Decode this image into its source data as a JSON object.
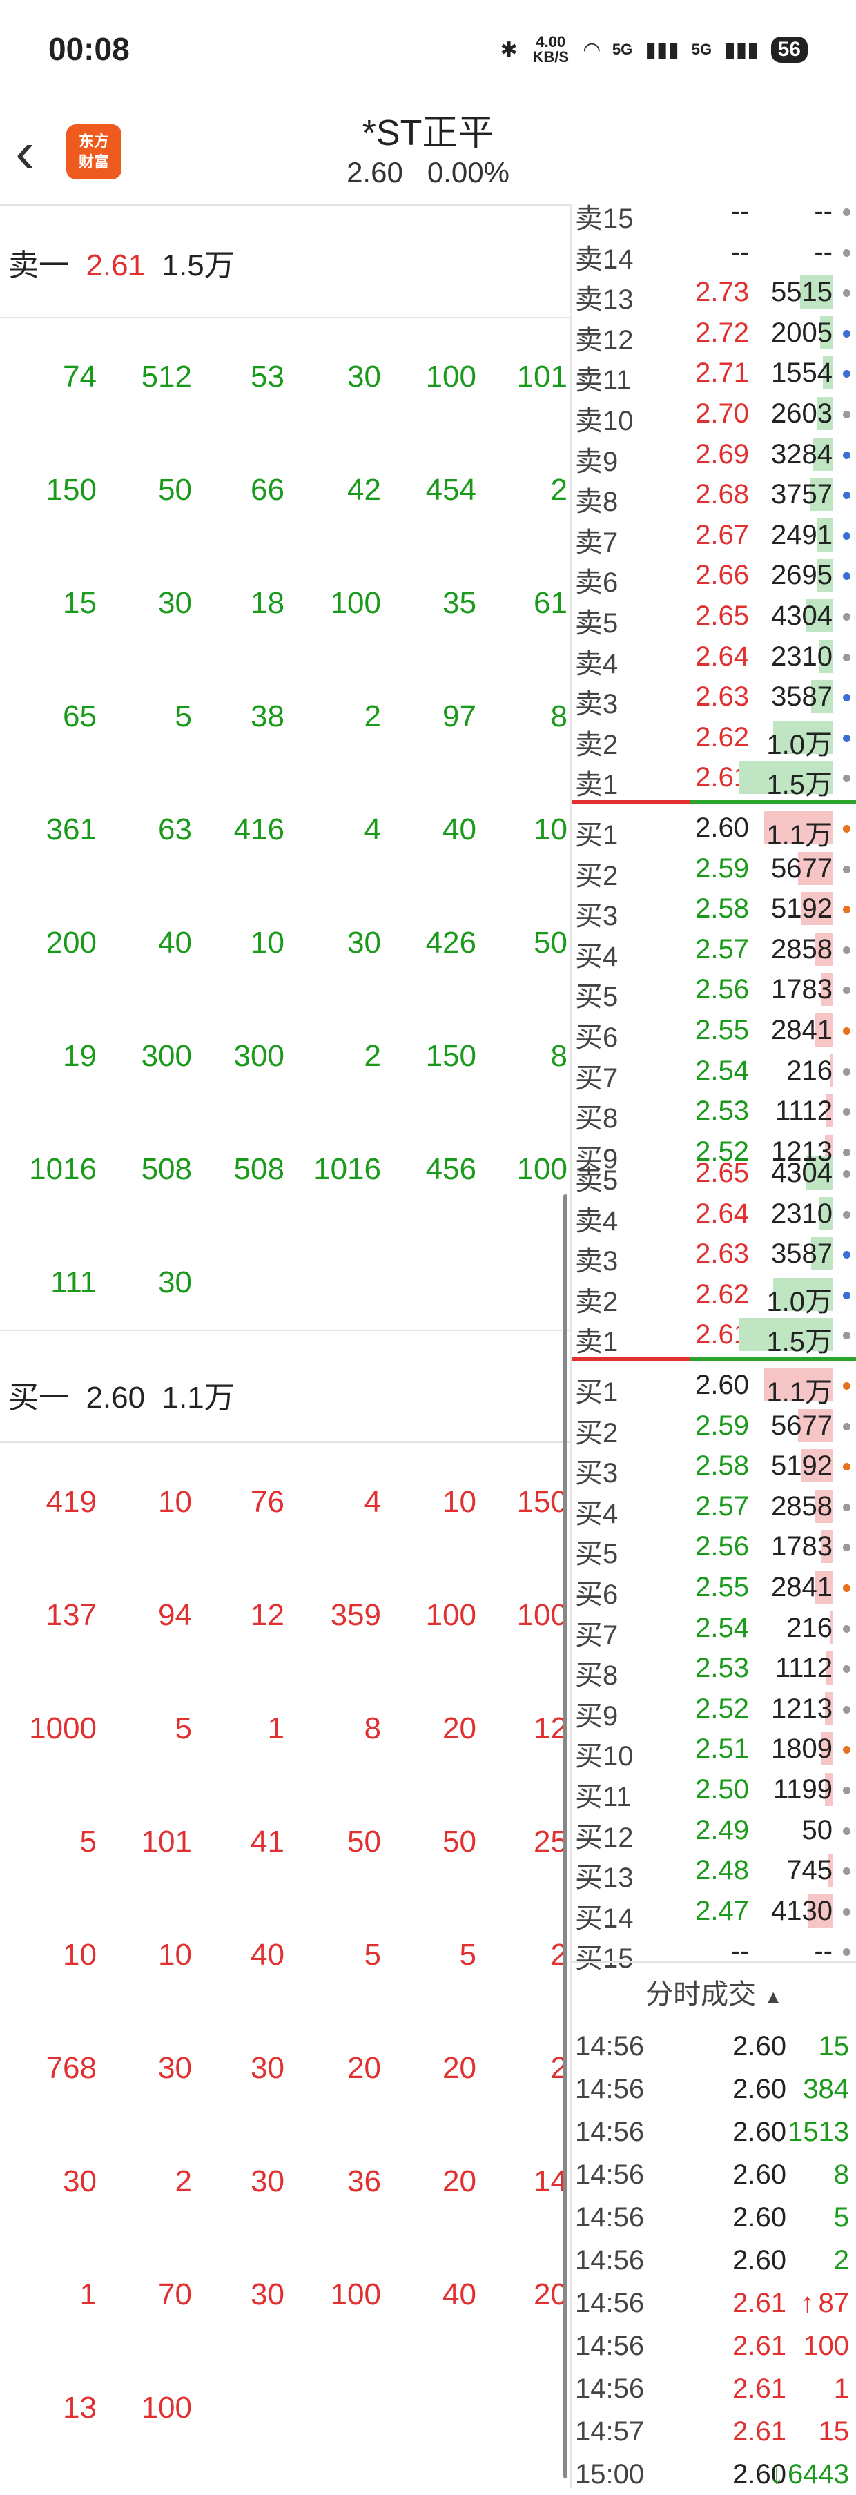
{
  "status_bar": {
    "time": "00:08",
    "net_speed": "4.00 KB/S",
    "signal1": "5G",
    "signal2": "5G",
    "battery": "56"
  },
  "header": {
    "back_icon": "chevron-left-icon",
    "logo_line1": "东方",
    "logo_line2": "财富",
    "title": "*ST正平",
    "price": "2.60",
    "change": "0.00%"
  },
  "left": {
    "sell_header": {
      "label": "卖一",
      "price": "2.61",
      "volume": "1.5万"
    },
    "sell_rows": [
      [
        "74",
        "512",
        "53",
        "30",
        "100",
        "101"
      ],
      [
        "150",
        "50",
        "66",
        "42",
        "454",
        "2"
      ],
      [
        "15",
        "30",
        "18",
        "100",
        "35",
        "61"
      ],
      [
        "65",
        "5",
        "38",
        "2",
        "97",
        "8"
      ],
      [
        "361",
        "63",
        "416",
        "4",
        "40",
        "10"
      ],
      [
        "200",
        "40",
        "10",
        "30",
        "426",
        "50"
      ],
      [
        "19",
        "300",
        "300",
        "2",
        "150",
        "8"
      ],
      [
        "1016",
        "508",
        "508",
        "1016",
        "456",
        "100"
      ],
      [
        "111",
        "30",
        "",
        "",
        "",
        ""
      ]
    ],
    "buy_header": {
      "label": "买一",
      "price": "2.60",
      "volume": "1.1万"
    },
    "buy_rows": [
      [
        "419",
        "10",
        "76",
        "4",
        "10",
        "150"
      ],
      [
        "137",
        "94",
        "12",
        "359",
        "100",
        "100"
      ],
      [
        "1000",
        "5",
        "1",
        "8",
        "20",
        "12"
      ],
      [
        "5",
        "101",
        "41",
        "50",
        "50",
        "25"
      ],
      [
        "10",
        "10",
        "40",
        "5",
        "5",
        "2"
      ],
      [
        "768",
        "30",
        "30",
        "20",
        "20",
        "2"
      ],
      [
        "30",
        "2",
        "30",
        "36",
        "20",
        "14"
      ],
      [
        "1",
        "70",
        "30",
        "100",
        "40",
        "20"
      ],
      [
        "13",
        "100",
        "",
        "",
        "",
        ""
      ]
    ]
  },
  "right": {
    "book1": [
      {
        "label": "卖15",
        "price": "--",
        "vol": "--",
        "side": "sell",
        "dot": "#999999",
        "fill": 0
      },
      {
        "label": "卖14",
        "price": "--",
        "vol": "--",
        "side": "sell",
        "dot": "#999999",
        "fill": 0
      },
      {
        "label": "卖13",
        "price": "2.73",
        "vol": "5515",
        "side": "sell",
        "dot": "#999999",
        "fill": 0.35
      },
      {
        "label": "卖12",
        "price": "2.72",
        "vol": "2005",
        "side": "sell",
        "dot": "#3b6fd8",
        "fill": 0.13
      },
      {
        "label": "卖11",
        "price": "2.71",
        "vol": "1554",
        "side": "sell",
        "dot": "#3b6fd8",
        "fill": 0.1
      },
      {
        "label": "卖10",
        "price": "2.70",
        "vol": "2603",
        "side": "sell",
        "dot": "#999999",
        "fill": 0.17
      },
      {
        "label": "卖9",
        "price": "2.69",
        "vol": "3284",
        "side": "sell",
        "dot": "#3b6fd8",
        "fill": 0.21
      },
      {
        "label": "卖8",
        "price": "2.68",
        "vol": "3757",
        "side": "sell",
        "dot": "#3b6fd8",
        "fill": 0.24
      },
      {
        "label": "卖7",
        "price": "2.67",
        "vol": "2491",
        "side": "sell",
        "dot": "#3b6fd8",
        "fill": 0.16
      },
      {
        "label": "卖6",
        "price": "2.66",
        "vol": "2695",
        "side": "sell",
        "dot": "#3b6fd8",
        "fill": 0.17
      },
      {
        "label": "卖5",
        "price": "2.65",
        "vol": "4304",
        "side": "sell",
        "dot": "#999999",
        "fill": 0.28
      },
      {
        "label": "卖4",
        "price": "2.64",
        "vol": "2310",
        "side": "sell",
        "dot": "#999999",
        "fill": 0.15
      },
      {
        "label": "卖3",
        "price": "2.63",
        "vol": "3587",
        "side": "sell",
        "dot": "#3b6fd8",
        "fill": 0.23
      },
      {
        "label": "卖2",
        "price": "2.62",
        "vol": "1.0万",
        "side": "sell",
        "dot": "#3b6fd8",
        "fill": 0.64
      },
      {
        "label": "卖1",
        "price": "2.61",
        "vol": "1.5万",
        "side": "sell",
        "dot": "#999999",
        "fill": 1.0
      },
      {
        "label": "买1",
        "price": "2.60",
        "vol": "1.1万",
        "side": "buy",
        "dot": "#e8721c",
        "fill": 0.73
      },
      {
        "label": "买2",
        "price": "2.59",
        "vol": "5677",
        "side": "buy",
        "dot": "#999999",
        "fill": 0.37
      },
      {
        "label": "买3",
        "price": "2.58",
        "vol": "5192",
        "side": "buy",
        "dot": "#e8721c",
        "fill": 0.34
      },
      {
        "label": "买4",
        "price": "2.57",
        "vol": "2858",
        "side": "buy",
        "dot": "#999999",
        "fill": 0.19
      },
      {
        "label": "买5",
        "price": "2.56",
        "vol": "1783",
        "side": "buy",
        "dot": "#999999",
        "fill": 0.12
      },
      {
        "label": "买6",
        "price": "2.55",
        "vol": "2841",
        "side": "buy",
        "dot": "#e8721c",
        "fill": 0.19
      },
      {
        "label": "买7",
        "price": "2.54",
        "vol": "216",
        "side": "buy",
        "dot": "#999999",
        "fill": 0.02
      },
      {
        "label": "买8",
        "price": "2.53",
        "vol": "1112",
        "side": "buy",
        "dot": "#999999",
        "fill": 0.07
      },
      {
        "label": "买9",
        "price": "2.52",
        "vol": "1213",
        "side": "buy",
        "dot": "#999999",
        "fill": 0.08
      }
    ],
    "book2": [
      {
        "label": "卖5",
        "price": "2.65",
        "vol": "4304",
        "side": "sell",
        "dot": "#999999",
        "fill": 0.28
      },
      {
        "label": "卖4",
        "price": "2.64",
        "vol": "2310",
        "side": "sell",
        "dot": "#999999",
        "fill": 0.15
      },
      {
        "label": "卖3",
        "price": "2.63",
        "vol": "3587",
        "side": "sell",
        "dot": "#3b6fd8",
        "fill": 0.23
      },
      {
        "label": "卖2",
        "price": "2.62",
        "vol": "1.0万",
        "side": "sell",
        "dot": "#3b6fd8",
        "fill": 0.64
      },
      {
        "label": "卖1",
        "price": "2.61",
        "vol": "1.5万",
        "side": "sell",
        "dot": "#999999",
        "fill": 1.0
      },
      {
        "label": "买1",
        "price": "2.60",
        "vol": "1.1万",
        "side": "buy",
        "dot": "#e8721c",
        "fill": 0.73
      },
      {
        "label": "买2",
        "price": "2.59",
        "vol": "5677",
        "side": "buy",
        "dot": "#999999",
        "fill": 0.37
      },
      {
        "label": "买3",
        "price": "2.58",
        "vol": "5192",
        "side": "buy",
        "dot": "#e8721c",
        "fill": 0.34
      },
      {
        "label": "买4",
        "price": "2.57",
        "vol": "2858",
        "side": "buy",
        "dot": "#999999",
        "fill": 0.19
      },
      {
        "label": "买5",
        "price": "2.56",
        "vol": "1783",
        "side": "buy",
        "dot": "#999999",
        "fill": 0.12
      },
      {
        "label": "买6",
        "price": "2.55",
        "vol": "2841",
        "side": "buy",
        "dot": "#e8721c",
        "fill": 0.19
      },
      {
        "label": "买7",
        "price": "2.54",
        "vol": "216",
        "side": "buy",
        "dot": "#999999",
        "fill": 0.02
      },
      {
        "label": "买8",
        "price": "2.53",
        "vol": "1112",
        "side": "buy",
        "dot": "#999999",
        "fill": 0.07
      },
      {
        "label": "买9",
        "price": "2.52",
        "vol": "1213",
        "side": "buy",
        "dot": "#999999",
        "fill": 0.08
      },
      {
        "label": "买10",
        "price": "2.51",
        "vol": "1809",
        "side": "buy",
        "dot": "#e8721c",
        "fill": 0.12
      },
      {
        "label": "买11",
        "price": "2.50",
        "vol": "1199",
        "side": "buy",
        "dot": "#999999",
        "fill": 0.08
      },
      {
        "label": "买12",
        "price": "2.49",
        "vol": "50",
        "side": "buy",
        "dot": "#999999",
        "fill": 0.0
      },
      {
        "label": "买13",
        "price": "2.48",
        "vol": "745",
        "side": "buy",
        "dot": "#999999",
        "fill": 0.05
      },
      {
        "label": "买14",
        "price": "2.47",
        "vol": "4130",
        "side": "buy",
        "dot": "#999999",
        "fill": 0.27
      },
      {
        "label": "买15",
        "price": "--",
        "vol": "--",
        "side": "buy",
        "dot": "#999999",
        "fill": 0
      }
    ],
    "trades_title": "分时成交",
    "trades": [
      {
        "time": "14:56",
        "price": "2.60",
        "vol": "15",
        "dir": "sell",
        "arrow": ""
      },
      {
        "time": "14:56",
        "price": "2.60",
        "vol": "384",
        "dir": "sell",
        "arrow": ""
      },
      {
        "time": "14:56",
        "price": "2.60",
        "vol": "1513",
        "dir": "sell",
        "arrow": ""
      },
      {
        "time": "14:56",
        "price": "2.60",
        "vol": "8",
        "dir": "sell",
        "arrow": ""
      },
      {
        "time": "14:56",
        "price": "2.60",
        "vol": "5",
        "dir": "sell",
        "arrow": ""
      },
      {
        "time": "14:56",
        "price": "2.60",
        "vol": "2",
        "dir": "sell",
        "arrow": ""
      },
      {
        "time": "14:56",
        "price": "2.61",
        "vol": "87",
        "dir": "buy",
        "arrow": "↑"
      },
      {
        "time": "14:56",
        "price": "2.61",
        "vol": "100",
        "dir": "buy",
        "arrow": ""
      },
      {
        "time": "14:56",
        "price": "2.61",
        "vol": "1",
        "dir": "buy",
        "arrow": ""
      },
      {
        "time": "14:57",
        "price": "2.61",
        "vol": "15",
        "dir": "buy",
        "arrow": ""
      },
      {
        "time": "15:00",
        "price": "2.60",
        "vol": "6443",
        "dir": "sell",
        "arrow": "↓"
      }
    ]
  },
  "colors": {
    "sell": "#1a9a1a",
    "buy": "#e03030",
    "brand": "#ef5b1e"
  }
}
